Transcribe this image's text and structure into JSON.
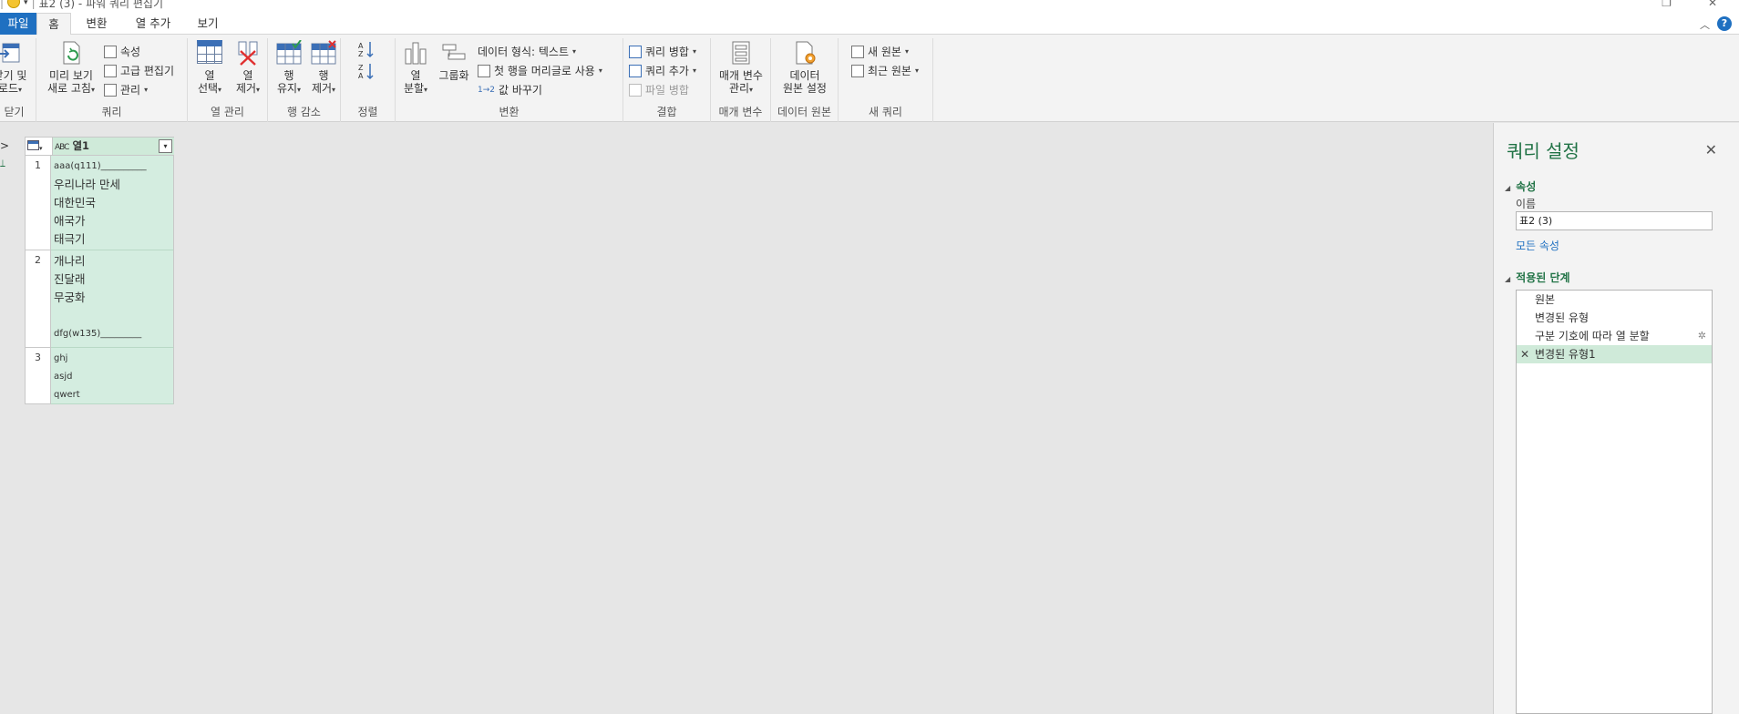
{
  "window": {
    "title": "표2 (3) - 파워 쿼리 편집기"
  },
  "tabs": [
    {
      "label": "파일"
    },
    {
      "label": "홈"
    },
    {
      "label": "변환"
    },
    {
      "label": "열 추가"
    },
    {
      "label": "보기"
    }
  ],
  "ribbon": {
    "close_group": {
      "btn_line1": "닫기 및",
      "btn_line2": "로드",
      "label": "닫기"
    },
    "query_group": {
      "refresh_line1": "미리 보기",
      "refresh_line2": "새로 고침",
      "properties": "속성",
      "advanced_editor": "고급 편집기",
      "manage": "관리",
      "label": "쿼리"
    },
    "column_group": {
      "choose_line1": "열",
      "choose_line2": "선택",
      "remove_line1": "열",
      "remove_line2": "제거",
      "label": "열 관리"
    },
    "rows_group": {
      "keep_line1": "행",
      "keep_line2": "유지",
      "remove_line1": "행",
      "remove_line2": "제거",
      "label": "행 감소"
    },
    "sort_group": {
      "label": "정렬"
    },
    "transform_group": {
      "split_line1": "열",
      "split_line2": "분할",
      "group_by": "그룹화",
      "data_type": "데이터 형식: 텍스트",
      "first_row": "첫 행을 머리글로 사용",
      "replace": "값 바꾸기",
      "label": "변환"
    },
    "combine_group": {
      "merge": "쿼리 병합",
      "append": "쿼리 추가",
      "combine_files": "파일 병합",
      "label": "결합"
    },
    "params_group": {
      "btn_line1": "매개 변수",
      "btn_line2": "관리",
      "label": "매개 변수"
    },
    "datasource_group": {
      "btn_line1": "데이터",
      "btn_line2": "원본 설정",
      "label": "데이터 원본"
    },
    "newquery_group": {
      "new_source": "새 원본",
      "recent_sources": "최근 원본",
      "label": "새 쿼리"
    }
  },
  "grid": {
    "column_header": "열1",
    "type_icon": "ABC",
    "rows": [
      {
        "num": "1",
        "lines": [
          "aaa(q111)__________",
          "우리나라 만세",
          "대한민국",
          "애국가",
          "태극기"
        ]
      },
      {
        "num": "2",
        "lines": [
          "개나리",
          "진달래",
          "무궁화",
          "",
          "dfg(w135)_________"
        ]
      },
      {
        "num": "3",
        "lines": [
          "ghj",
          "asjd",
          "qwert"
        ]
      }
    ]
  },
  "query_settings": {
    "title": "쿼리 설정",
    "properties_section": "속성",
    "name_label": "이름",
    "name_value": "표2 (3)",
    "all_properties": "모든 속성",
    "steps_section": "적용된 단계",
    "steps": [
      {
        "label": "원본"
      },
      {
        "label": "변경된 유형"
      },
      {
        "label": "구분 기호에 따라 열 분할"
      },
      {
        "label": "변경된 유형1"
      }
    ]
  },
  "colors": {
    "accent": "#217346",
    "file_tab": "#1f70c1",
    "cell_highlight": "#d4ede0"
  }
}
